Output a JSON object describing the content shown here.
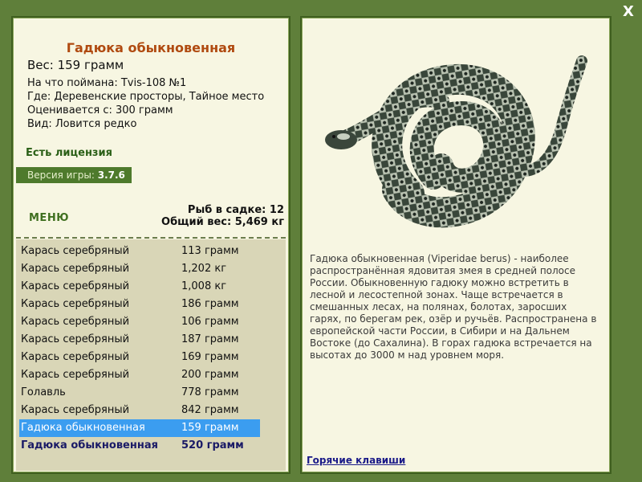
{
  "close_label": "X",
  "fish": {
    "title": "Гадюка обыкновенная",
    "weight": "Вес: 159 грамм",
    "caught_on": "На что поймана: Tvis-108 №1",
    "location": "Где: Деревенские просторы, Тайное место",
    "valued_from": "Оценивается с: 300 грамм",
    "rarity": "Вид: Ловится редко"
  },
  "license": "Есть лицензия",
  "version": {
    "label": "Версия игры:",
    "value": "3.7.6"
  },
  "menu_label": "МЕНЮ",
  "keepnet": {
    "count": "Рыб в садке: 12",
    "total": "Общий вес: 5,469 кг"
  },
  "catch_list": [
    {
      "name": "Карась серебряный",
      "weight": "113 грамм"
    },
    {
      "name": "Карась серебряный",
      "weight": "1,202 кг"
    },
    {
      "name": "Карась серебряный",
      "weight": "1,008 кг"
    },
    {
      "name": "Карась серебряный",
      "weight": "186 грамм"
    },
    {
      "name": "Карась серебряный",
      "weight": "106 грамм"
    },
    {
      "name": "Карась серебряный",
      "weight": "187 грамм"
    },
    {
      "name": "Карась серебряный",
      "weight": "169 грамм"
    },
    {
      "name": "Карась серебряный",
      "weight": "200 грамм"
    },
    {
      "name": "Голавль",
      "weight": "778 грамм"
    },
    {
      "name": "Карась серебряный",
      "weight": "842 грамм"
    },
    {
      "name": "Гадюка обыкновенная",
      "weight": "159 грамм"
    },
    {
      "name": "Гадюка обыкновенная",
      "weight": "520 грамм"
    }
  ],
  "description": "Гадюка обыкновенная (Viperidae berus) - наиболее распространённая ядовитая змея в средней полосе России. Обыкновенную гадюку можно встретить в лесной и лесостепной зонах. Чаще встречается в смешанных лесах, на полянах, болотах, заросших гарях, по берегам рек, озёр и ручьёв. Распространена в европейской части России, в Сибири и на Дальнем Востоке (до Сахалина). В горах гадюка встречается на высотах до 3000 м над уровнем моря.",
  "hotkeys_label": "Горячие клавиши",
  "colors": {
    "background": "#5f7f3a",
    "panel": "#f7f6e2",
    "title": "#b04a10",
    "selected": "#3b9df0"
  }
}
